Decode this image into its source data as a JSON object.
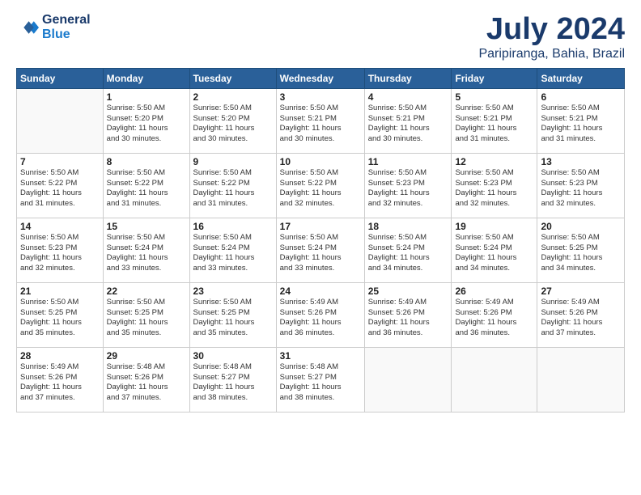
{
  "logo": {
    "line1": "General",
    "line2": "Blue"
  },
  "title": "July 2024",
  "subtitle": "Paripiranga, Bahia, Brazil",
  "days_of_week": [
    "Sunday",
    "Monday",
    "Tuesday",
    "Wednesday",
    "Thursday",
    "Friday",
    "Saturday"
  ],
  "weeks": [
    [
      {
        "day": "",
        "info": ""
      },
      {
        "day": "1",
        "info": "Sunrise: 5:50 AM\nSunset: 5:20 PM\nDaylight: 11 hours\nand 30 minutes."
      },
      {
        "day": "2",
        "info": "Sunrise: 5:50 AM\nSunset: 5:20 PM\nDaylight: 11 hours\nand 30 minutes."
      },
      {
        "day": "3",
        "info": "Sunrise: 5:50 AM\nSunset: 5:21 PM\nDaylight: 11 hours\nand 30 minutes."
      },
      {
        "day": "4",
        "info": "Sunrise: 5:50 AM\nSunset: 5:21 PM\nDaylight: 11 hours\nand 30 minutes."
      },
      {
        "day": "5",
        "info": "Sunrise: 5:50 AM\nSunset: 5:21 PM\nDaylight: 11 hours\nand 31 minutes."
      },
      {
        "day": "6",
        "info": "Sunrise: 5:50 AM\nSunset: 5:21 PM\nDaylight: 11 hours\nand 31 minutes."
      }
    ],
    [
      {
        "day": "7",
        "info": "Sunrise: 5:50 AM\nSunset: 5:22 PM\nDaylight: 11 hours\nand 31 minutes."
      },
      {
        "day": "8",
        "info": "Sunrise: 5:50 AM\nSunset: 5:22 PM\nDaylight: 11 hours\nand 31 minutes."
      },
      {
        "day": "9",
        "info": "Sunrise: 5:50 AM\nSunset: 5:22 PM\nDaylight: 11 hours\nand 31 minutes."
      },
      {
        "day": "10",
        "info": "Sunrise: 5:50 AM\nSunset: 5:22 PM\nDaylight: 11 hours\nand 32 minutes."
      },
      {
        "day": "11",
        "info": "Sunrise: 5:50 AM\nSunset: 5:23 PM\nDaylight: 11 hours\nand 32 minutes."
      },
      {
        "day": "12",
        "info": "Sunrise: 5:50 AM\nSunset: 5:23 PM\nDaylight: 11 hours\nand 32 minutes."
      },
      {
        "day": "13",
        "info": "Sunrise: 5:50 AM\nSunset: 5:23 PM\nDaylight: 11 hours\nand 32 minutes."
      }
    ],
    [
      {
        "day": "14",
        "info": "Sunrise: 5:50 AM\nSunset: 5:23 PM\nDaylight: 11 hours\nand 32 minutes."
      },
      {
        "day": "15",
        "info": "Sunrise: 5:50 AM\nSunset: 5:24 PM\nDaylight: 11 hours\nand 33 minutes."
      },
      {
        "day": "16",
        "info": "Sunrise: 5:50 AM\nSunset: 5:24 PM\nDaylight: 11 hours\nand 33 minutes."
      },
      {
        "day": "17",
        "info": "Sunrise: 5:50 AM\nSunset: 5:24 PM\nDaylight: 11 hours\nand 33 minutes."
      },
      {
        "day": "18",
        "info": "Sunrise: 5:50 AM\nSunset: 5:24 PM\nDaylight: 11 hours\nand 34 minutes."
      },
      {
        "day": "19",
        "info": "Sunrise: 5:50 AM\nSunset: 5:24 PM\nDaylight: 11 hours\nand 34 minutes."
      },
      {
        "day": "20",
        "info": "Sunrise: 5:50 AM\nSunset: 5:25 PM\nDaylight: 11 hours\nand 34 minutes."
      }
    ],
    [
      {
        "day": "21",
        "info": "Sunrise: 5:50 AM\nSunset: 5:25 PM\nDaylight: 11 hours\nand 35 minutes."
      },
      {
        "day": "22",
        "info": "Sunrise: 5:50 AM\nSunset: 5:25 PM\nDaylight: 11 hours\nand 35 minutes."
      },
      {
        "day": "23",
        "info": "Sunrise: 5:50 AM\nSunset: 5:25 PM\nDaylight: 11 hours\nand 35 minutes."
      },
      {
        "day": "24",
        "info": "Sunrise: 5:49 AM\nSunset: 5:26 PM\nDaylight: 11 hours\nand 36 minutes."
      },
      {
        "day": "25",
        "info": "Sunrise: 5:49 AM\nSunset: 5:26 PM\nDaylight: 11 hours\nand 36 minutes."
      },
      {
        "day": "26",
        "info": "Sunrise: 5:49 AM\nSunset: 5:26 PM\nDaylight: 11 hours\nand 36 minutes."
      },
      {
        "day": "27",
        "info": "Sunrise: 5:49 AM\nSunset: 5:26 PM\nDaylight: 11 hours\nand 37 minutes."
      }
    ],
    [
      {
        "day": "28",
        "info": "Sunrise: 5:49 AM\nSunset: 5:26 PM\nDaylight: 11 hours\nand 37 minutes."
      },
      {
        "day": "29",
        "info": "Sunrise: 5:48 AM\nSunset: 5:26 PM\nDaylight: 11 hours\nand 37 minutes."
      },
      {
        "day": "30",
        "info": "Sunrise: 5:48 AM\nSunset: 5:27 PM\nDaylight: 11 hours\nand 38 minutes."
      },
      {
        "day": "31",
        "info": "Sunrise: 5:48 AM\nSunset: 5:27 PM\nDaylight: 11 hours\nand 38 minutes."
      },
      {
        "day": "",
        "info": ""
      },
      {
        "day": "",
        "info": ""
      },
      {
        "day": "",
        "info": ""
      }
    ]
  ]
}
